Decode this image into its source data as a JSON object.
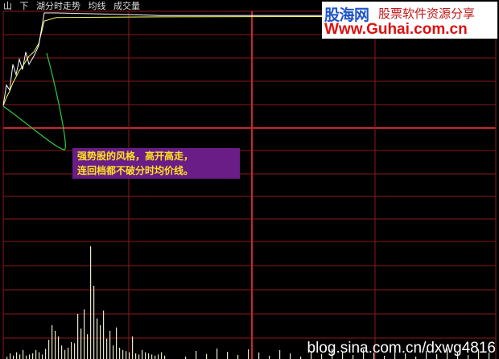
{
  "header": {
    "mountain_glyph": "山",
    "down_label": "下",
    "title": "湖分时走势",
    "avg_label": "均线",
    "vol_label": "成交量"
  },
  "logo": {
    "name_cn": "股海网",
    "slogan": "股票软件资源分享",
    "url": "Www.Guhai.com.cn"
  },
  "annotation": {
    "line1": "强势股的风格，高开高走，",
    "line2": "连回档都不破分时均价线。"
  },
  "watermark": "blog.sina.com.cn/dxwg4816",
  "colors": {
    "grid": "#8b1a1a",
    "midline": "#c62828",
    "price_line": "#ffffff",
    "avg_line": "#ffff66",
    "highlight_curve": "#2ecc40",
    "volume": "#e8e8c8",
    "note_bg": "#6a1d86",
    "note_text": "#ffe21f"
  },
  "chart_data": {
    "type": "line",
    "series": [
      {
        "values": [
          0.1,
          0.3,
          0.25,
          0.5,
          0.4,
          0.55,
          0.45,
          0.62,
          0.5,
          0.58,
          0.68,
          1.0,
          1.0,
          0.975,
          0.975
        ]
      },
      {
        "values": [
          0.1,
          0.18,
          0.24,
          0.32,
          0.38,
          0.44,
          0.48,
          0.53,
          0.58,
          0.62,
          0.7,
          0.92,
          0.955,
          0.962,
          0.965
        ]
      }
    ],
    "volume": [
      0.02,
      0.05,
      0.03,
      0.06,
      0.04,
      0.08,
      0.03,
      0.04,
      0.05,
      0.08,
      0.06,
      0.04,
      0.09,
      0.17,
      0.3,
      0.25,
      0.2,
      0.12,
      0.08,
      0.1,
      0.15,
      0.14,
      0.4,
      0.27,
      0.44,
      0.22,
      1.0,
      0.65,
      0.36,
      0.3,
      0.43,
      0.18,
      0.25,
      0.12,
      0.28,
      0.1,
      0.08,
      0.07,
      0.06,
      0.2,
      0.05,
      0.04,
      0.08,
      0.06,
      0.05,
      0.04,
      0.03,
      0.04,
      0.06,
      0.03
    ]
  }
}
